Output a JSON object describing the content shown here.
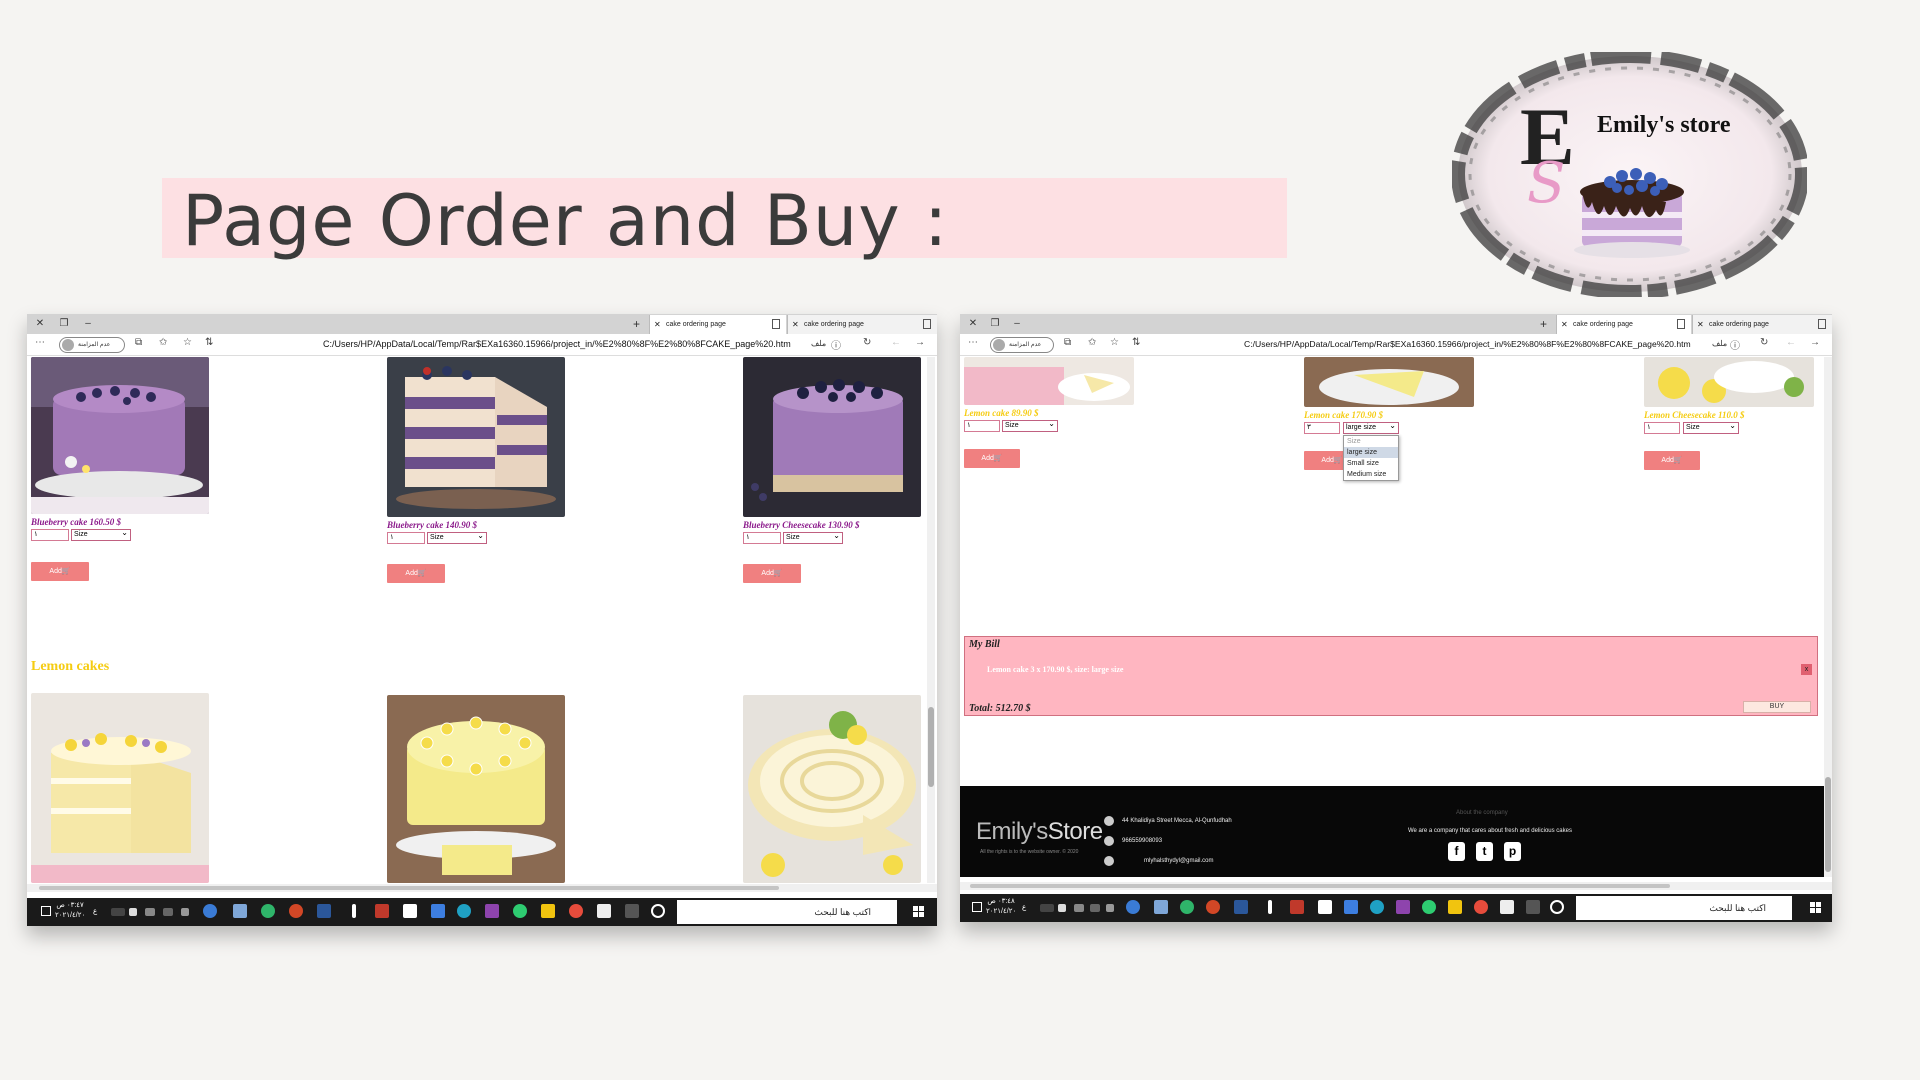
{
  "slide": {
    "title": "Page Order and Buy :"
  },
  "logo": {
    "initials": "E",
    "script_initial": "S",
    "name": "Emily's store"
  },
  "browser": {
    "tab_label": "cake ordering page",
    "url": "C:/Users/HP/AppData/Local/Temp/Rar$EXa16360.15966/project_in/%E2%80%8F%E2%80%8FCAKE_page%20.htm",
    "file_label": "ملف",
    "profile_label": "عدم المزامنة"
  },
  "left_page": {
    "cakes": [
      {
        "name": "Blueberry cake 160.50 $",
        "qty": "١",
        "size": "Size",
        "add": "Add🛒"
      },
      {
        "name": "Blueberry cake 140.90 $",
        "qty": "١",
        "size": "Size",
        "add": "Add🛒"
      },
      {
        "name": "Blueberry Cheesecake 130.90 $",
        "qty": "١",
        "size": "Size",
        "add": "Add🛒"
      }
    ],
    "section_heading": "Lemon cakes"
  },
  "right_page": {
    "cakes": [
      {
        "name": "Lemon cake 89.90 $",
        "qty": "١",
        "size": "Size",
        "add": "Add🛒"
      },
      {
        "name": "Lemon cake 170.90 $",
        "qty": "٣",
        "size": "large size",
        "add": "Add🛒"
      },
      {
        "name": "Lemon Cheesecake 110.0 $",
        "qty": "١",
        "size": "Size",
        "add": "Add🛒"
      }
    ],
    "size_options": [
      "Size",
      "large size",
      "Small size",
      "Medium size"
    ],
    "selected_option": "large size",
    "bill": {
      "title": "My Bill",
      "item": "Lemon cake 3 x 170.90 $, size: large size",
      "remove": "x",
      "total": "Total: 512.70 $",
      "buy": "BUY"
    },
    "footer": {
      "brand_a": "Emily's",
      "brand_b": "Store",
      "rights": "All the rights is to the website owner. © 2020",
      "address": "44 Khalidiya Street Mecca, Al-Qunfudhah",
      "phone": "966559908093",
      "email": "mlyhalsthydyl@gmail.com",
      "about_title": "About the company",
      "about_text": "We are a company that cares about fresh and delicious cakes",
      "social": [
        "f",
        "t",
        "p"
      ]
    }
  },
  "taskbar": {
    "search_placeholder": "اكتب هنا للبحث",
    "left_time": "٠٣:٤٧ ص",
    "left_date": "٢٠٢١/٤/٢٠",
    "right_time": "٠٣:٤٨ ص",
    "right_date": "٢٠٢١/٤/٢٠",
    "lang": "ع"
  },
  "colors": {
    "title_band": "#fde0e3",
    "blueberry_text": "#8b1a8b",
    "lemon_text": "#f5cc12",
    "add_button": "#f08080",
    "bill_bg": "#ffb6c1"
  }
}
